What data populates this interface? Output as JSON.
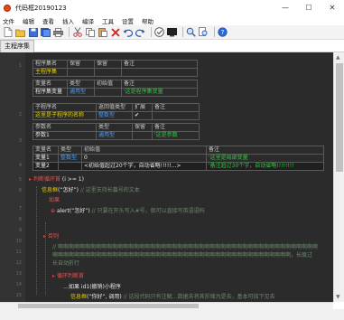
{
  "window": {
    "title": "代码框20190123",
    "minimize": "—",
    "maximize": "☐",
    "close": "✕"
  },
  "menu": [
    "文件",
    "编辑",
    "查看",
    "插入",
    "编译",
    "工具",
    "设置",
    "帮助"
  ],
  "toolbar_icons": [
    "new-file-icon",
    "open-file-icon",
    "save-icon",
    "save-all-icon",
    "print-icon",
    "cut-icon",
    "copy-icon",
    "paste-icon",
    "delete-icon",
    "undo-icon",
    "redo-icon",
    "check-icon",
    "screen-icon",
    "search-icon",
    "replace-icon",
    "help-icon"
  ],
  "tab": {
    "label": "主程序集"
  },
  "program_set": {
    "headers": [
      "程序集名",
      "保留",
      "保留",
      "备注"
    ],
    "name": "主程序集",
    "var_headers": [
      "变量名",
      "类型",
      "初始值",
      "备注"
    ],
    "var_name": "程序集变量",
    "var_type": "通用型",
    "var_note": "'这是程序集变量"
  },
  "subprogram": {
    "headers": [
      "子程序名",
      "返回值类型",
      "扩展",
      "备注"
    ],
    "name": "这里是子程序的名称",
    "return_type": "整数型",
    "extend": "✔",
    "param_headers": [
      "参数名",
      "类型",
      "保留",
      "备注"
    ],
    "param_name": "参数1",
    "param_type": "通用型",
    "param_note": "'这是参数"
  },
  "locals": {
    "headers": [
      "变量名",
      "类型",
      "初始值",
      "备注"
    ],
    "rows": [
      {
        "name": "变量1",
        "type": "整数型",
        "init": "0",
        "note": "'这里是局部变量"
      },
      {
        "name": "变量2",
        "type": "",
        "init": "<初始值超过20个字，自动省略!!!!!...>",
        "note": "'备注超过30个字，自动省略!!!!!!!!"
      }
    ]
  },
  "code": {
    "line1_kw": "判断循环首",
    "line1_rest": "(i >= 1)",
    "line2_kw": "信息框",
    "line2_str": "(“怎好”)",
    "line2_comment": "// 这里支持长篇号的文本",
    "line3_kw": "如果",
    "line4_kw": "alert",
    "line4_str": "(“怎好”)",
    "line4_comment": "// 只要在开头写入#号，就可以直接写英语语码",
    "line6_kw": "否则",
    "line7": "// 啊啊啊啊啊啊啊啊啊啊啊啊啊啊啊啊啊啊啊啊啊啊啊啊啊啊啊啊啊啊啊啊啊啊啊啊啊啊啊啊啊啊啊啊啊啊啊啊",
    "line8": "啊啊啊啊啊啊啊啊啊啊啊啊啊啊啊啊啊啊啊啊啊啊啊啊啊啊啊啊啊啊啊啊啊啊啊啊啊啊啊啊啊啊啊啊，长度过",
    "line9": "长自动折行",
    "line10_kw": "循环判断首",
    "line11": "…如果 id1(撤销)小程序",
    "line12_kw": "信息框",
    "line12_str": "(“你好”, 调用)",
    "line12_comment": "// 这段代码只有注解…数据去将其折缩为是去，基本可接下见去"
  },
  "line_numbers": [
    "1",
    "2",
    "3",
    "4",
    "5",
    "6",
    "7",
    "8",
    "9",
    "10",
    "11",
    "12",
    "13",
    "14",
    "15",
    "16",
    "17",
    "18",
    "19",
    "20",
    "21",
    "22",
    "23",
    "24"
  ],
  "colors": {
    "editor_bg": "#2b2b2b",
    "keyword_red": "#e55050",
    "keyword_yellow": "#e6c800",
    "type_blue": "#4a9eff",
    "comment_green": "#2ecc40"
  }
}
